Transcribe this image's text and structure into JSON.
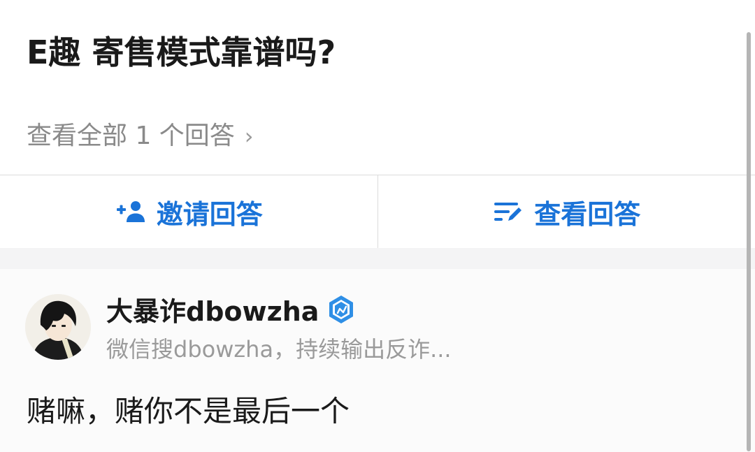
{
  "question": {
    "title": "E趣 寄售模式靠谱吗?",
    "view_all_label": "查看全部 1 个回答",
    "view_all_chevron": "›"
  },
  "actions": {
    "invite": {
      "label": "邀请回答",
      "icon": "add-person-icon"
    },
    "view": {
      "label": "查看回答",
      "icon": "list-edit-icon"
    }
  },
  "answer": {
    "author_name": "大暴诈dbowzha",
    "author_bio": "微信搜dbowzha，持续输出反诈...",
    "verified_icon": "verified-badge-icon",
    "avatar_icon": "avatar-anime-boy",
    "text": "赌嘛，赌你不是最后一个"
  },
  "colors": {
    "accent": "#1a73d8",
    "title": "#1a1a1a",
    "muted": "#8a8a8a",
    "divider": "#dcdcdc",
    "band": "#f4f4f5"
  }
}
